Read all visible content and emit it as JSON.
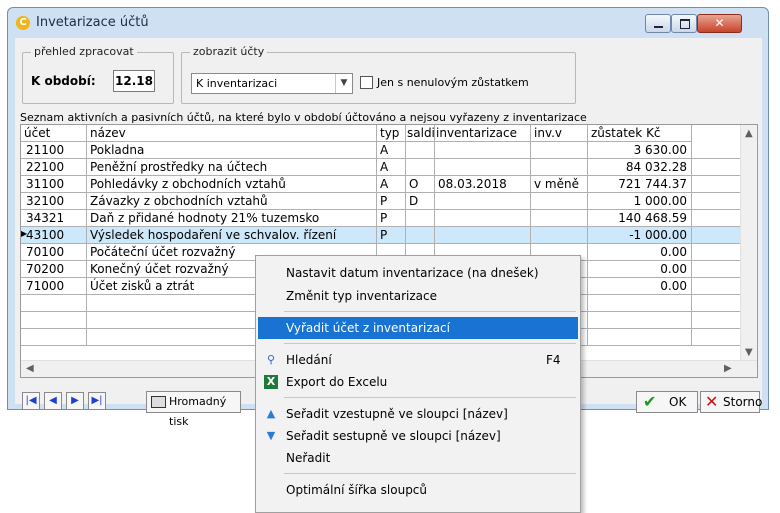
{
  "window": {
    "title": "Invetarizace účtů"
  },
  "group_overview": {
    "legend": "přehled zpracovat",
    "period_label": "K období:",
    "period_value": "12.18"
  },
  "group_display": {
    "legend": "zobrazit účty",
    "combo_value": "K inventarizaci",
    "checkbox_label": "Jen s nenulovým zůstatkem",
    "checkbox_checked": false
  },
  "description": "Seznam aktivních a pasivních účtů, na které bylo v období účtováno a nejsou vyřazeny z inventarizace",
  "table": {
    "headers": [
      "účet",
      "název",
      "typ",
      "saldi",
      "inventarizace",
      "inv.v",
      "zůstatek Kč"
    ],
    "rows": [
      [
        "21100",
        "Pokladna",
        "A",
        "",
        "",
        "",
        "3 630.00"
      ],
      [
        "22100",
        "Peněžní prostředky na účtech",
        "A",
        "",
        "",
        "",
        "84 032.28"
      ],
      [
        "31100",
        "Pohledávky z obchodních vztahů",
        "A",
        "O",
        "08.03.2018",
        "v měně",
        "721 744.37"
      ],
      [
        "32100",
        "Závazky z obchodních vztahů",
        "P",
        "D",
        "",
        "",
        "1 000.00"
      ],
      [
        "34321",
        "Daň z přidané hodnoty 21% tuzemsko",
        "P",
        "",
        "",
        "",
        "140 468.59"
      ],
      [
        "43100",
        "Výsledek hospodaření ve schvalov. řízení",
        "P",
        "",
        "",
        "",
        "-1 000.00"
      ],
      [
        "70100",
        "Počáteční účet rozvažný",
        "",
        "",
        "",
        "",
        "0.00"
      ],
      [
        "70200",
        "Konečný účet rozvažný",
        "",
        "",
        "",
        "",
        "0.00"
      ],
      [
        "71000",
        "Účet zisků a ztrát",
        "",
        "",
        "",
        "",
        "0.00"
      ]
    ],
    "selected_row": 5
  },
  "bottom": {
    "mass_print_label": "Hromadný tisk",
    "ok_label": "OK",
    "storno_label": "Storno"
  },
  "context_menu": {
    "items": [
      {
        "label": "Nastavit datum inventarizace (na dnešek)"
      },
      {
        "label": "Změnit typ inventarizace"
      },
      {
        "label": "Vyřadit účet z inventarizací",
        "highlighted": true
      },
      {
        "label": "Hledání",
        "shortcut": "F4",
        "icon": "search-icon"
      },
      {
        "label": "Export do Excelu",
        "icon": "excel-icon"
      },
      {
        "label": "Seřadit vzestupně ve sloupci [název]",
        "icon": "sort-ascending-icon"
      },
      {
        "label": "Seřadit sestupně ve sloupci [název]",
        "icon": "sort-descending-icon"
      },
      {
        "label": "Neřadit"
      },
      {
        "label": "Optimální šířka sloupců"
      }
    ]
  },
  "colors": {
    "selection": "#cde8fb",
    "menu_highlight": "#1873d3",
    "nav_arrows": "#1d3fd8"
  }
}
